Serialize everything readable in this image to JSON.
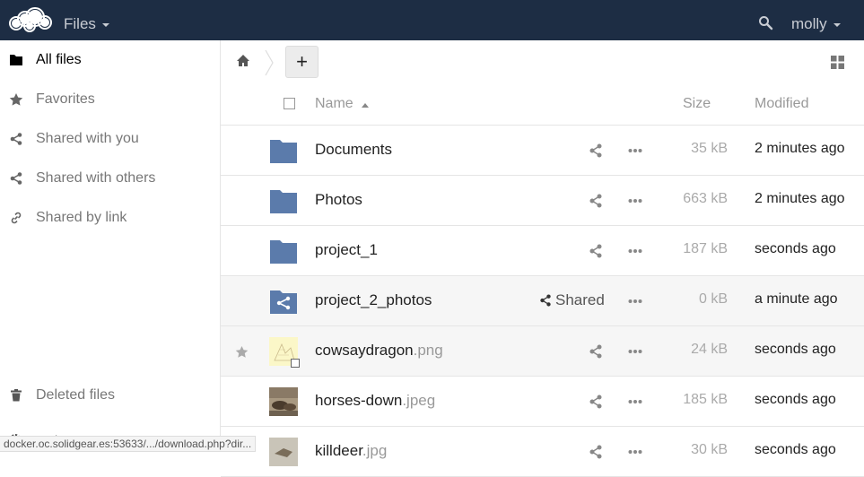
{
  "header": {
    "app_name": "Files",
    "user_name": "molly",
    "bg_color": "#1d2d44"
  },
  "sidebar": {
    "items": [
      {
        "label": "All files",
        "icon": "folder-icon",
        "active": true
      },
      {
        "label": "Favorites",
        "icon": "star-icon"
      },
      {
        "label": "Shared with you",
        "icon": "share-icon"
      },
      {
        "label": "Shared with others",
        "icon": "share-icon"
      },
      {
        "label": "Shared by link",
        "icon": "link-icon"
      }
    ],
    "deleted_label": "Deleted files",
    "settings_label": "Settings"
  },
  "status_bar": {
    "url": "docker.oc.solidgear.es:53633/.../download.php?dir..."
  },
  "controls": {
    "new_label": "+"
  },
  "table": {
    "headers": {
      "name": "Name",
      "size": "Size",
      "modified": "Modified"
    },
    "rows": [
      {
        "name": "Documents",
        "ext": "",
        "type": "folder",
        "size": "35 kB",
        "modified": "2 minutes ago"
      },
      {
        "name": "Photos",
        "ext": "",
        "type": "folder",
        "size": "663 kB",
        "modified": "2 minutes ago"
      },
      {
        "name": "project_1",
        "ext": "",
        "type": "folder",
        "size": "187 kB",
        "modified": "seconds ago"
      },
      {
        "name": "project_2_photos",
        "ext": "",
        "type": "shared-folder",
        "size": "0 kB",
        "modified": "a minute ago",
        "shared_label": "Shared"
      },
      {
        "name": "cowsaydragon",
        "ext": ".png",
        "type": "image",
        "size": "24 kB",
        "modified": "seconds ago"
      },
      {
        "name": "horses-down",
        "ext": ".jpeg",
        "type": "image",
        "size": "185 kB",
        "modified": "seconds ago"
      },
      {
        "name": "killdeer",
        "ext": ".jpg",
        "type": "image",
        "size": "30 kB",
        "modified": "seconds ago"
      }
    ]
  },
  "colors": {
    "folder": "#5b7bab",
    "accent": "#1d2d44"
  }
}
